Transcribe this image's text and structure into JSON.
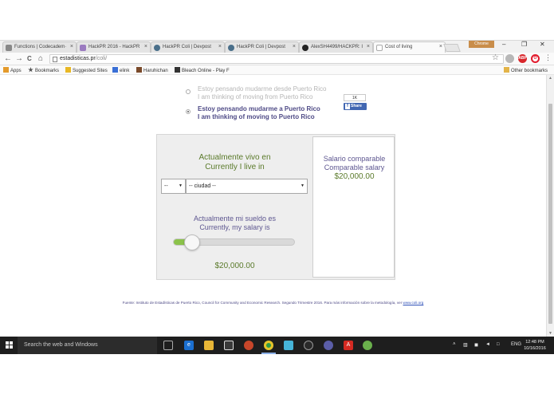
{
  "browser": {
    "tabs": [
      {
        "title": "Functions | Codecadem·",
        "favicon_color": "#888888"
      },
      {
        "title": "HackPR 2016 - HackPR",
        "favicon_color": "#9b7bc0"
      },
      {
        "title": "HackPR Coli | Devpost",
        "favicon_color": "#4a6f8a"
      },
      {
        "title": "HackPR Coli | Devpost",
        "favicon_color": "#4a6f8a"
      },
      {
        "title": "AlexSH4499/HACKPR: I",
        "favicon_color": "#222222"
      },
      {
        "title": "Cost of living",
        "favicon_color": "#bbbbbb"
      }
    ],
    "tab_close": "×",
    "user_label": "Chrome",
    "window_controls": {
      "minimize": "–",
      "maximize": "❐",
      "close": "✕"
    },
    "nav": {
      "back": "←",
      "forward": "→",
      "reload": "C",
      "home": "⌂"
    },
    "address": {
      "domain": "estadisticas.pr",
      "path": "/coli/"
    },
    "star": "☆",
    "menu": "⋮",
    "extensions": [
      {
        "name": "cloud-extension-icon",
        "color": "#b8b8b8",
        "label": ""
      },
      {
        "name": "adblock-icon",
        "color": "#d9262b",
        "label": "ABP"
      },
      {
        "name": "opera-icon",
        "color": "#e21a2c",
        "label": "O"
      }
    ],
    "bookmarks": [
      {
        "label": "Apps",
        "icon_color": "#e49a2b"
      },
      {
        "label": "Bookmarks",
        "icon_color": "#555555"
      },
      {
        "label": "Suggested Sites",
        "icon_color": "#e9b825"
      },
      {
        "label": "elink",
        "icon_color": "#3a6fd6"
      },
      {
        "label": "Haruhichan",
        "icon_color": "#7a4a2a"
      },
      {
        "label": "Bleach Online - Play F",
        "icon_color": "#333333"
      }
    ],
    "other_bookmarks": "Other bookmarks"
  },
  "page": {
    "option_from": {
      "line1": "Estoy pensando mudarme desde Puerto Rico",
      "line2": "I am thinking of moving from Puerto Rico"
    },
    "option_to": {
      "line1": "Estoy pensando mudarme a Puerto Rico",
      "line2": "I am thinking of moving to Puerto Rico"
    },
    "selected_option": "option_to",
    "facebook": {
      "count": "1K",
      "share": "Share",
      "f": "f"
    },
    "live_in": {
      "line1": "Actualmente vivo en",
      "line2": "Currently I live in"
    },
    "state_select": {
      "value": "--",
      "arrow": "▼"
    },
    "city_select": {
      "value": "-- ciudad --",
      "arrow": "▼"
    },
    "salary_label": {
      "line1": "Actualmente mi sueldo es",
      "line2": "Currently, my salary is"
    },
    "salary_slider_level": 0.16,
    "salary_value": "$20,000.00",
    "comparable": {
      "line1": "Salario comparable",
      "line2": "Comparable salary",
      "value": "$20,000.00"
    },
    "footer": {
      "text": "Fuente: Instituto de Estadísticas de Puerto Rico, Council for Community and Economic Research. Segundo Trimestre 2016. Para más información sobre la metodología, ver ",
      "link": "www.coli.org"
    },
    "colors": {
      "green": "#5a7a2a",
      "purple": "#5d5690",
      "slider_fill": "#8bc24a",
      "panel_bg": "#eeeeee"
    }
  },
  "taskbar": {
    "search_placeholder": "Search the web and Windows",
    "apps": [
      {
        "name": "task-view-icon",
        "color": "#1e1e1e",
        "glyph": "▣"
      },
      {
        "name": "edge-icon",
        "color": "#1b6fd0",
        "glyph": "e"
      },
      {
        "name": "file-explorer-icon",
        "color": "#e8b637",
        "glyph": "▬"
      },
      {
        "name": "store-icon",
        "color": "#3a3a3a",
        "glyph": "▤"
      },
      {
        "name": "media-icon",
        "color": "#c8462a",
        "glyph": "●"
      },
      {
        "name": "chrome-icon",
        "color": "#2f9b45",
        "glyph": "◉"
      },
      {
        "name": "app-icon",
        "color": "#46b4d8",
        "glyph": "■"
      },
      {
        "name": "github-icon",
        "color": "#2a2a2a",
        "glyph": "●"
      },
      {
        "name": "eclipse-icon",
        "color": "#5b5ea8",
        "glyph": "●"
      },
      {
        "name": "acrobat-icon",
        "color": "#d42a22",
        "glyph": "A"
      },
      {
        "name": "pdf-icon",
        "color": "#b82020",
        "glyph": "▲"
      },
      {
        "name": "android-icon",
        "color": "#6ab04c",
        "glyph": "●"
      }
    ],
    "tray": {
      "chevron": "˄",
      "network": "▥",
      "volume": "◄",
      "notifications": "□",
      "language": "ENG"
    },
    "time": "12:48 PM",
    "date": "10/16/2016"
  }
}
